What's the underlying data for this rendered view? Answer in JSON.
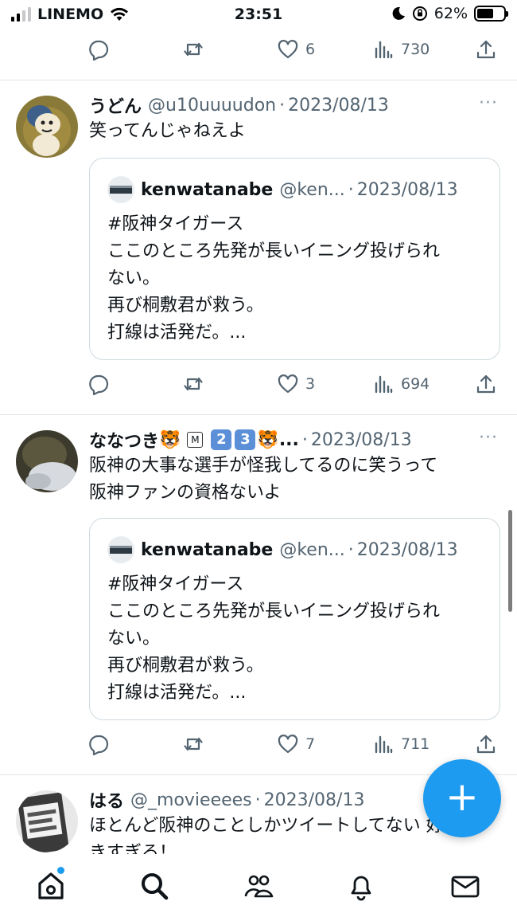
{
  "status_bar": {
    "carrier": "LINEMO",
    "time": "23:51",
    "battery": "62%",
    "battery_level": 0.62
  },
  "top_actions": {
    "likes": "6",
    "views": "730"
  },
  "tweets": [
    {
      "name": "うどん",
      "handle": "@u10uuuudon",
      "dot": "·",
      "date": "2023/08/13",
      "more": "···",
      "text": "笑ってんじゃねえよ",
      "quote": {
        "name": "kenwatanabe",
        "handle": "@ken...",
        "dot": "·",
        "date": "2023/08/13",
        "lines": [
          "#阪神タイガース",
          "ここのところ先発が長いイニング投げられ",
          "ない。",
          "再び桐敷君が救う。",
          "打線は活発だ。..."
        ]
      },
      "likes": "3",
      "views": "694"
    },
    {
      "name": "ななつき",
      "name_emoji_1": "🐯",
      "name_emoji_m": "M",
      "name_emoji_2": "2",
      "name_emoji_3": "3",
      "name_emoji_4": "🐯",
      "name_ellipsis": "...",
      "dot": "·",
      "date": "2023/08/13",
      "more": "···",
      "text_lines": [
        "阪神の大事な選手が怪我してるのに笑うって",
        "阪神ファンの資格ないよ"
      ],
      "quote": {
        "name": "kenwatanabe",
        "handle": "@ken...",
        "dot": "·",
        "date": "2023/08/13",
        "lines": [
          "#阪神タイガース",
          "ここのところ先発が長いイニング投げられ",
          "ない。",
          "再び桐敷君が救う。",
          "打線は活発だ。..."
        ]
      },
      "likes": "7",
      "views": "711"
    },
    {
      "name": "はる",
      "handle": "@_movieeees",
      "dot": "·",
      "date": "2023/08/13",
      "text_lines": [
        "ほとんど阪神のことしかツイートしてない 好",
        "きすぎる！"
      ]
    }
  ],
  "fab_label": "+",
  "colors": {
    "accent": "#1d9bf0",
    "secondary_text": "#536471",
    "border": "#cfd9de"
  }
}
